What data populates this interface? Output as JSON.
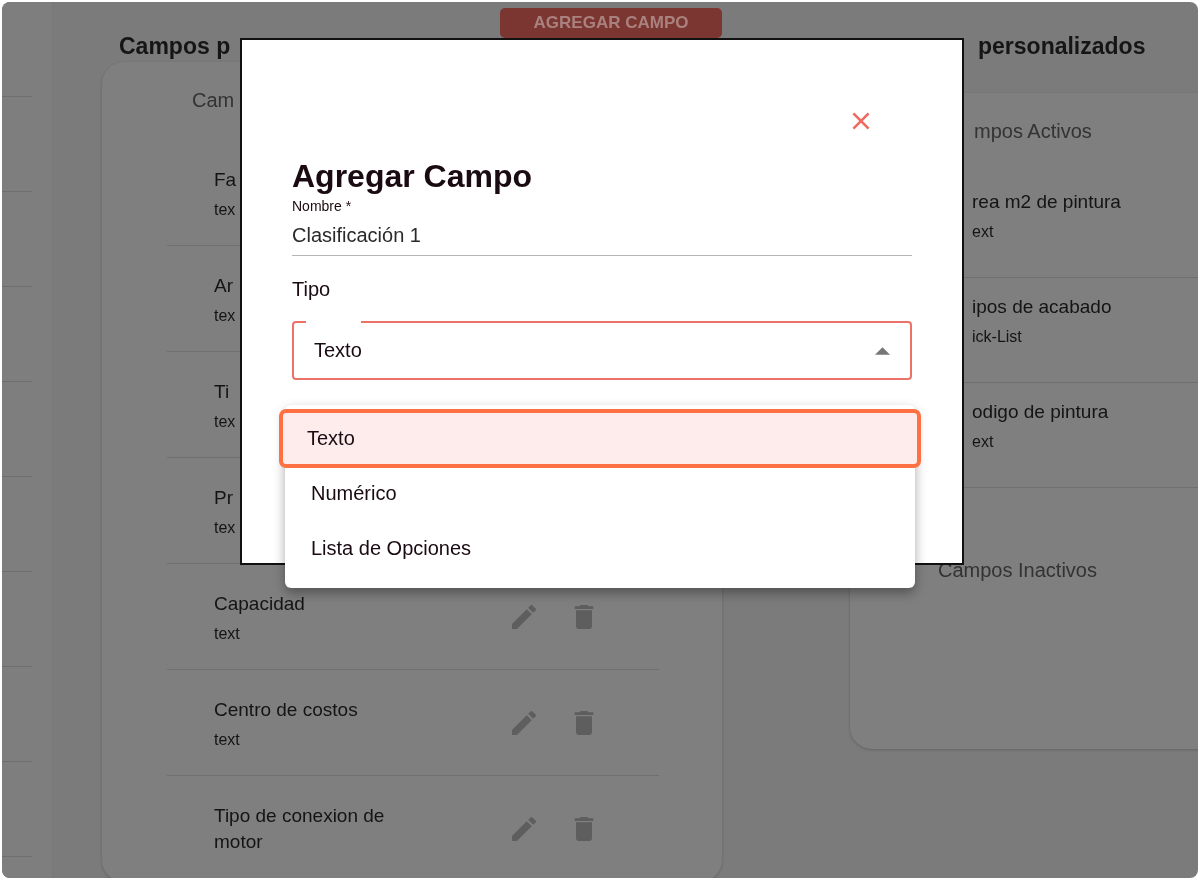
{
  "left_panel": {
    "heading": "Campos p",
    "add_button": "AGREGAR CAMPO",
    "card": {
      "header": "Cam",
      "rows": [
        {
          "name": "Fa",
          "type": "tex"
        },
        {
          "name": "Ar",
          "type": "tex"
        },
        {
          "name": "Ti",
          "type": "tex"
        },
        {
          "name": "Pr",
          "type": "tex"
        },
        {
          "name": "Capacidad",
          "type": "text",
          "actions_visible": true
        },
        {
          "name": "Centro de costos",
          "type": "text",
          "actions_visible": true
        },
        {
          "name": "Tipo de conexion de motor",
          "actions_visible": true
        }
      ]
    }
  },
  "right_panel": {
    "heading": "personalizados",
    "active_card": {
      "header": "mpos Activos",
      "items": [
        {
          "name": "rea m2 de pintura",
          "type": "ext"
        },
        {
          "name": "ipos de acabado",
          "type": "ick-List"
        },
        {
          "name": "odigo de pintura",
          "type": "ext"
        }
      ],
      "inactive_header": "Campos Inactivos"
    }
  },
  "dialog": {
    "title": "Agregar Campo",
    "name_field": {
      "label": "Nombre *",
      "value": "Clasificación 1"
    },
    "type_field": {
      "label": "Tipo",
      "value": "Texto",
      "expanded": true,
      "options": [
        {
          "label": "Texto",
          "selected": true
        },
        {
          "label": "Numérico",
          "selected": false
        },
        {
          "label": "Lista de Opciones",
          "selected": false
        }
      ]
    }
  }
}
